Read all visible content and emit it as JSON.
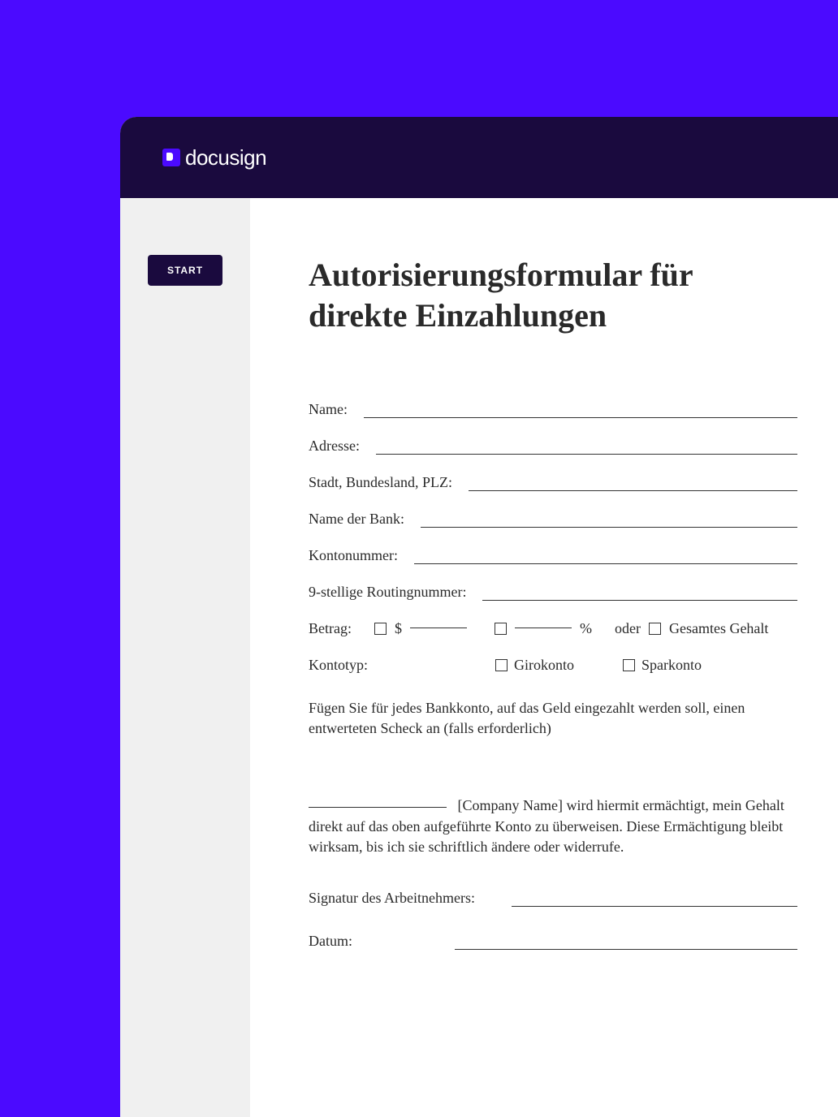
{
  "header": {
    "brand": "docusign"
  },
  "sidebar": {
    "start_button": "START"
  },
  "document": {
    "title": "Autorisierungsformular für direkte Einzahlungen",
    "fields": {
      "name": "Name:",
      "address": "Adresse:",
      "city_state_zip": "Stadt, Bundesland, PLZ:",
      "bank_name": "Name der Bank:",
      "account_number": "Kontonummer:",
      "routing_number": "9-stellige Routingnummer:",
      "amount": "Betrag:",
      "dollar_sign": "$",
      "percent_sign": "%",
      "or_text": "oder",
      "entire_paycheck": "Gesamtes Gehalt",
      "account_type": "Kontotyp:",
      "checking": "Girokonto",
      "savings": "Sparkonto"
    },
    "note": "Fügen Sie für jedes Bankkonto, auf das Geld eingezahlt werden soll, einen entwerteten Scheck an (falls erforderlich)",
    "authorization": "[Company Name] wird hiermit ermächtigt, mein Gehalt direkt auf das oben aufgeführte Konto zu überweisen. Diese Ermächtigung bleibt wirksam, bis ich sie schriftlich ändere oder widerrufe.",
    "signature_label": "Signatur des Arbeitnehmers:",
    "date_label": "Datum:"
  }
}
